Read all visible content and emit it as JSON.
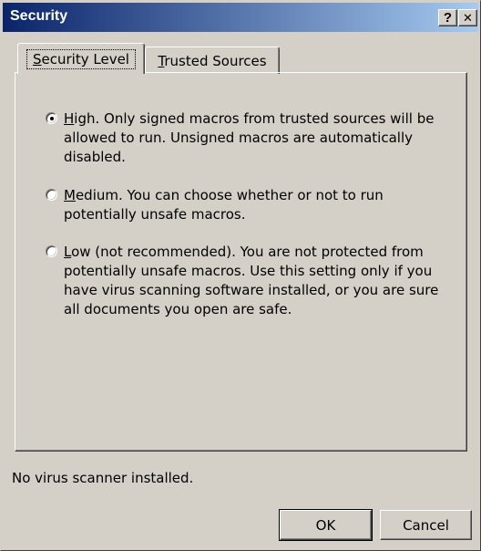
{
  "window": {
    "title": "Security",
    "help_button": "?",
    "close_button": "✕"
  },
  "tabs": [
    {
      "label": "Security Level",
      "mnemonic": "S",
      "rest": "ecurity Level",
      "active": true
    },
    {
      "label": "Trusted Sources",
      "mnemonic": "T",
      "rest": "rusted Sources",
      "active": false
    }
  ],
  "security_levels": [
    {
      "mnemonic": "H",
      "text_after_mnemonic": "igh. Only signed macros from trusted sources will be allowed to run. Unsigned macros are automatically disabled.",
      "selected": true
    },
    {
      "mnemonic": "M",
      "text_after_mnemonic": "edium. You can choose whether or not to run potentially unsafe macros.",
      "selected": false
    },
    {
      "mnemonic": "L",
      "text_after_mnemonic": "ow (not recommended). You are not protected from potentially unsafe macros. Use this setting only if you have virus scanning software installed, or you are sure all documents you open are safe.",
      "selected": false
    }
  ],
  "status_text": "No virus scanner installed.",
  "buttons": {
    "ok": "OK",
    "cancel": "Cancel"
  }
}
